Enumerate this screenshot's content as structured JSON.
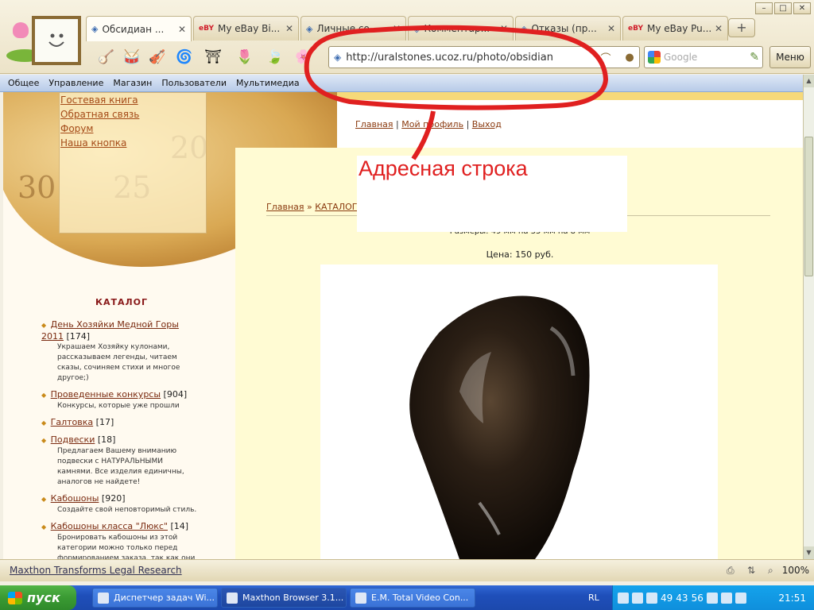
{
  "window": {
    "minimize": "–",
    "maximize": "□",
    "close": "✕"
  },
  "tabs": [
    {
      "label": "Обсидиан ...",
      "favicon": "ucoz-icon",
      "active": true
    },
    {
      "label": "My eBay Bi...",
      "favicon": "ebay-icon",
      "active": false
    },
    {
      "label": "Личные со...",
      "favicon": "ucoz-icon",
      "active": false
    },
    {
      "label": "Комментар...",
      "favicon": "ucoz-icon",
      "active": false
    },
    {
      "label": "Отказы (пр...",
      "favicon": "ucoz-icon",
      "active": false
    },
    {
      "label": "My eBay Pu...",
      "favicon": "ebay-icon",
      "active": false
    }
  ],
  "tab_close": "✕",
  "new_tab": "+",
  "address": {
    "url": "http://uralstones.ucoz.ru/photo/obsidian"
  },
  "search": {
    "placeholder": "Google"
  },
  "menu_button": "Меню",
  "ucoz_menu": [
    "Общее",
    "Управление",
    "Магазин",
    "Пользователи",
    "Мультимедиа"
  ],
  "side_links": [
    "Гостевая книга",
    "Обратная связь",
    "Форум",
    "Наша кнопка"
  ],
  "dial_numbers": [
    "30",
    "25",
    "20"
  ],
  "user_links": {
    "home": "Главная",
    "profile": "Мой профиль",
    "logout": "Выход",
    "sep": "|"
  },
  "breadcrumb": {
    "home": "Главная",
    "sep": "»",
    "catalog": "КАТАЛОГ",
    "sep2": "»"
  },
  "product": {
    "size_text": "Размеры: 49 мм на 35 мм на 8 мм",
    "price_text": "Цена: 150 руб."
  },
  "catalog": {
    "title": "КАТАЛОГ",
    "items": [
      {
        "name": "День Хозяйки Медной Горы 2011",
        "count": "[174]",
        "desc": "Украшаем Хозяйку кулонами, рассказываем легенды, читаем сказы, сочиняем стихи и многое другое;)"
      },
      {
        "name": "Проведенные конкурсы",
        "count": "[904]",
        "desc": "Конкурсы, которые уже прошли"
      },
      {
        "name": "Галтовка",
        "count": "[17]",
        "desc": ""
      },
      {
        "name": "Подвески",
        "count": "[18]",
        "desc": "Предлагаем Вашему вниманию подвески с НАТУРАЛЬНЫМИ камнями. Все изделия единичны, аналогов не найдете!"
      },
      {
        "name": "Кабошоны",
        "count": "[920]",
        "desc": "Создайте свой неповторимый стиль."
      },
      {
        "name": "Кабошоны класса \"Люкс\"",
        "count": "[14]",
        "desc": "Бронировать кабошоны из этой категории можно только перед формированием заказа, так как они размещены на других интернет-"
      }
    ]
  },
  "annotation": {
    "label": "Адресная строка",
    "color": "#e02020"
  },
  "statusbar": {
    "link": "Maxthon Transforms Legal Research",
    "zoom": "100%"
  },
  "taskbar": {
    "start": "пуск",
    "tasks": [
      "Диспетчер задач Wi...",
      "Maxthon Browser 3.1...",
      "E.M. Total Video Con..."
    ],
    "lang": "RL",
    "tray_numbers": [
      "49",
      "43",
      "56"
    ],
    "clock": "21:51"
  }
}
